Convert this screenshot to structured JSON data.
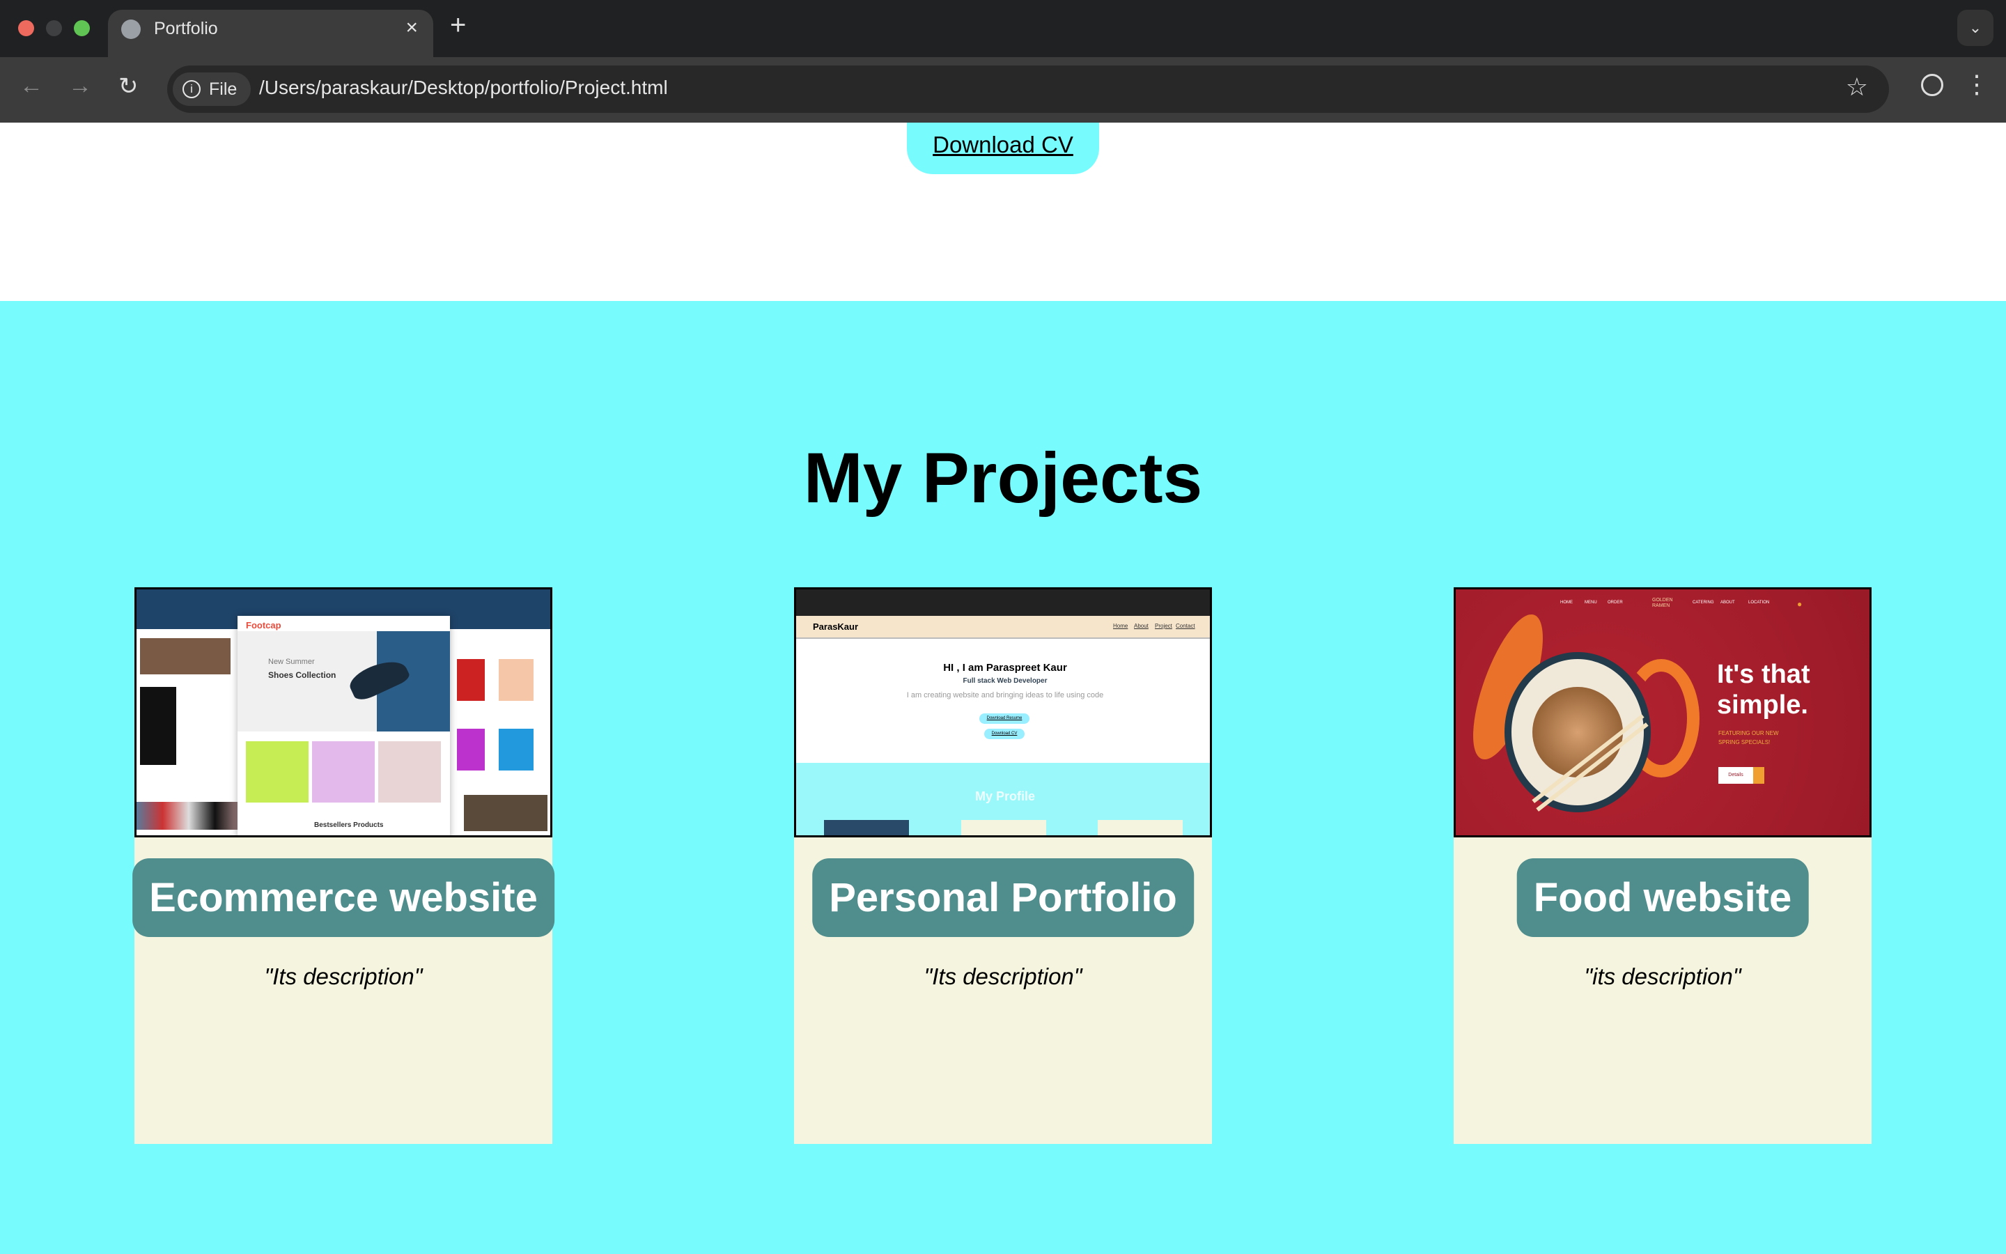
{
  "browser": {
    "tab_title": "Portfolio",
    "url_scheme": "File",
    "url": "/Users/paraskaur/Desktop/portfolio/Project.html"
  },
  "page": {
    "download_cv": "Download CV",
    "section_title": "My Projects",
    "projects": [
      {
        "title": "Ecommerce website",
        "description": "\"Its description\"",
        "thumbnail": {
          "brand": "Footcap",
          "headline_1": "New Summer",
          "headline_2": "Shoes Collection",
          "section": "Bestsellers Products"
        }
      },
      {
        "title": "Personal Portfolio",
        "description": "\"Its description\"",
        "thumbnail": {
          "brand": "ParasKaur",
          "nav": [
            "Home",
            "About",
            "Project",
            "Contact"
          ],
          "greeting": "HI , I am Paraspreet Kaur",
          "role": "Full stack Web Developer",
          "tagline": "I am creating website and bringing ideas to life using code",
          "buttons": [
            "Download Resume",
            "Download CV"
          ],
          "section": "My Profile"
        }
      },
      {
        "title": "Food website",
        "description": "\"its description\"",
        "thumbnail": {
          "nav_left": [
            "HOME",
            "MENU",
            "ORDER"
          ],
          "logo": "GOLDEN RAMEN",
          "nav_right": [
            "CATERING",
            "ABOUT",
            "LOCATION"
          ],
          "headline": "It's that simple.",
          "sub": "FEATURING OUR NEW SPRING SPECIALS!",
          "button": "Details"
        }
      }
    ]
  },
  "colors": {
    "page_bg": "#77fbfd",
    "card_bg": "#f5f5df",
    "pill_bg": "#508d8d"
  }
}
